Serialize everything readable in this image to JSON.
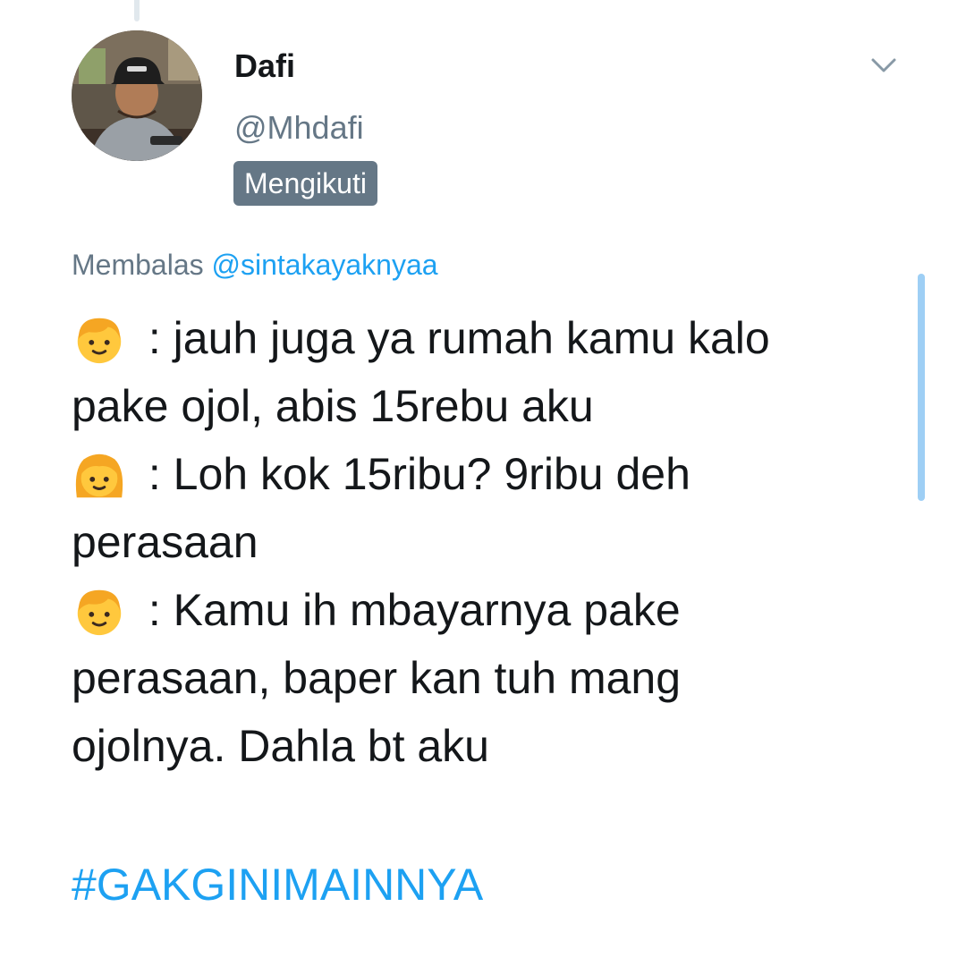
{
  "author": {
    "display_name": "Dafi",
    "handle": "@Mhdafi",
    "follow_status": "Mengikuti"
  },
  "reply_context": {
    "prefix": "Membalas",
    "mention": "@sintakayaknyaa"
  },
  "tweet": {
    "lines": [
      {
        "emoji": "boy-emoji",
        "text": " : jauh juga ya rumah kamu kalo"
      },
      {
        "emoji": null,
        "text": "pake ojol, abis 15rebu aku"
      },
      {
        "emoji": "girl-emoji",
        "text": " : Loh kok 15ribu? 9ribu deh"
      },
      {
        "emoji": null,
        "text": "perasaan"
      },
      {
        "emoji": "boy-emoji",
        "text": " : Kamu ih mbayarnya pake"
      },
      {
        "emoji": null,
        "text": "perasaan, baper kan tuh mang"
      },
      {
        "emoji": null,
        "text": "ojolnya. Dahla bt aku"
      }
    ],
    "hashtag": "#GAKGINIMAINNYA"
  },
  "icons": {
    "menu": "chevron-down-icon",
    "avatar": "profile-photo"
  },
  "colors": {
    "text_primary": "#14171a",
    "text_secondary": "#657786",
    "accent": "#1da1f2",
    "badge_bg": "#657786",
    "scroll_indicator": "#9ecff5",
    "thread_line": "#e1e8ed"
  }
}
